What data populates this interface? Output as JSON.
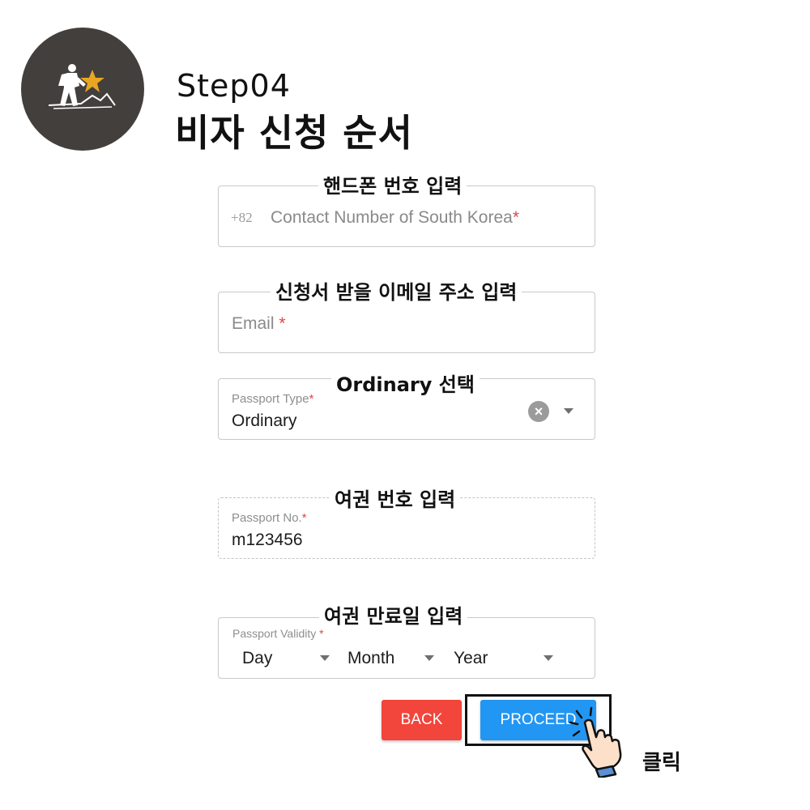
{
  "header": {
    "step": "Step04",
    "subtitle": "비자 신청 순서",
    "logo_icon": "hiker-star-logo-icon"
  },
  "annotations": {
    "phone": "핸드폰 번호 입력",
    "email": "신청서 받을 이메일 주소 입력",
    "passport_type": "Ordinary 선택",
    "passport_no": "여권 번호 입력",
    "passport_validity": "여권 만료일 입력",
    "click": "클릭"
  },
  "form": {
    "phone": {
      "prefix": "+82",
      "placeholder": "Contact Number of South Korea",
      "required_mark": "*"
    },
    "email": {
      "placeholder": "Email",
      "required_mark": "*"
    },
    "passport_type": {
      "label": "Passport Type",
      "required_mark": "*",
      "value": "Ordinary",
      "clear_icon": "clear-icon",
      "dropdown_icon": "chevron-down-icon"
    },
    "passport_no": {
      "label": "Passport No.",
      "required_mark": "*",
      "value": "m123456"
    },
    "passport_validity": {
      "label": "Passport Validity",
      "required_mark": "*",
      "day": "Day",
      "month": "Month",
      "year": "Year"
    }
  },
  "buttons": {
    "back": "BACK",
    "proceed": "PROCEED"
  },
  "colors": {
    "logo_bg": "#433f3c",
    "star": "#e9a623",
    "back": "#f2453b",
    "proceed": "#2296f3",
    "required": "#e0454a"
  }
}
